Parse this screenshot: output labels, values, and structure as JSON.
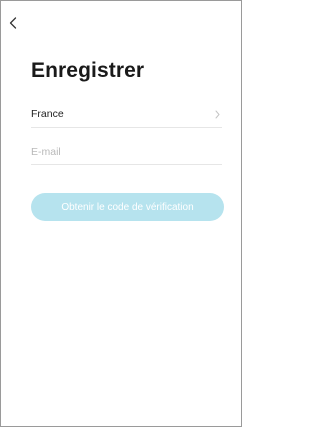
{
  "header": {
    "back_icon": "chevron-left-icon",
    "title": "Enregistrer"
  },
  "form": {
    "country": {
      "value": "France",
      "icon": "chevron-right-icon"
    },
    "email": {
      "placeholder": "E-mail",
      "value": ""
    },
    "submit_label": "Obtenir le code de vérification"
  },
  "colors": {
    "button_disabled": "#b6e3ee",
    "divider": "#e6e6e6",
    "placeholder": "#b9b9b9"
  }
}
